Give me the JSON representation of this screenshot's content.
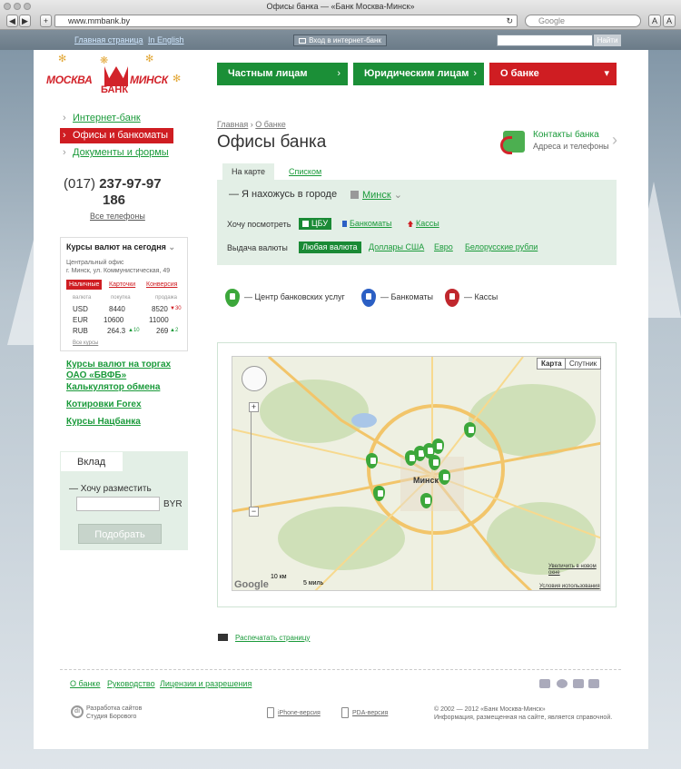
{
  "browser": {
    "title": "Офисы банка — «Банк Москва-Минск»",
    "url": "www.mmbank.by",
    "search_placeholder": "Google",
    "btn_a1": "A",
    "btn_a2": "A",
    "btn_add": "+"
  },
  "topbar": {
    "home": "Главная страница",
    "english": "In English",
    "login": "Вход в интернет-банк",
    "find": "Найти"
  },
  "logo": {
    "left": "МОСКВА",
    "right": "МИНСК",
    "bank": "БАНК",
    "brand_color": "#d2232a"
  },
  "nav": {
    "private": "Частным лицам",
    "legal": "Юридическим лицам",
    "about": "О банке",
    "arrow": "›",
    "arrow_down": "▾"
  },
  "sidebar": {
    "items": [
      {
        "label": "Интернет-банк"
      },
      {
        "label": "Офисы и банкоматы"
      },
      {
        "label": "Документы и формы"
      }
    ],
    "arrow": "›",
    "phone_code": "(017)",
    "phone_main": "237-97-97",
    "phone_ext": "186",
    "all_phones": "Все телефоны"
  },
  "rates": {
    "title": "Курсы валют на сегодня",
    "chev": "⌄",
    "office": "Центральный офис",
    "address": "г. Минск, ул. Коммунистическая, 49",
    "tabs": [
      "Наличные",
      "Карточки",
      "Конверсия"
    ],
    "col_currency": "валюта",
    "col_buy": "покупка",
    "col_sell": "продажа",
    "rows": [
      {
        "cur": "USD",
        "buy": "8440",
        "sell": "8520",
        "delta": "▼30"
      },
      {
        "cur": "EUR",
        "buy": "10600",
        "sell": "11000",
        "delta": ""
      },
      {
        "cur": "RUB",
        "buy": "264.3",
        "sell": "269",
        "delta": "▲2",
        "buy_delta": "▲10"
      }
    ],
    "all": "Все курсы"
  },
  "sidelinks": [
    "Курсы валют на торгах",
    "ОАО «БВФБ»",
    "Калькулятор обмена",
    "Котировки Forex",
    "Курсы Нацбанка"
  ],
  "deposit": {
    "tab": "Вклад",
    "question": "— Хочу разместить",
    "currency": "BYR",
    "button": "Подобрать"
  },
  "main": {
    "breadcrumb_home": "Главная",
    "breadcrumb_sep": "›",
    "breadcrumb_about": "О банке",
    "title": "Офисы банка",
    "contacts_title": "Контакты банка",
    "contacts_sub": "Адреса и телефоны",
    "contacts_arrow": "›",
    "view_map": "На карте",
    "view_list": "Списком",
    "city_label": "— Я нахожусь в городе",
    "city_value": "Минск",
    "city_chev": "⌄",
    "want_label": "Хочу посмотреть",
    "want_chips": [
      "ЦБУ",
      "Банкоматы",
      "Кассы"
    ],
    "currency_label": "Выдача валюты",
    "currency_chips": [
      "Любая валюта",
      "Доллары США",
      "Евро",
      "Белорусские рубли"
    ],
    "legend": [
      "— Центр банковских услуг",
      "— Банкоматы",
      "— Кассы"
    ],
    "map_btn_map": "Карта",
    "map_btn_sat": "Спутник",
    "map_scale_km": "10 км",
    "map_scale_mi": "5 миль",
    "map_enlarge": "Увеличить в новом окне",
    "map_terms": "Условия использования",
    "map_google": "Google",
    "map_city": "Минск",
    "print": "Распечатать страницу"
  },
  "footer": {
    "links": [
      "О банке",
      "Руководство",
      "Лицензии и разрешения"
    ],
    "dev1": "Разработка сайтов",
    "dev2": "Студия Борового",
    "dev_logo": "di",
    "iphone": "iPhone-версия",
    "pda": "PDA-версия",
    "copy1": "© 2002 — 2012 «Банк Москва-Минск»",
    "copy2": "Информация, размещенная на сайте, является справочной."
  },
  "colors": {
    "green": "#1a8a35",
    "red": "#cf1d22",
    "panel": "#e3efe6"
  }
}
